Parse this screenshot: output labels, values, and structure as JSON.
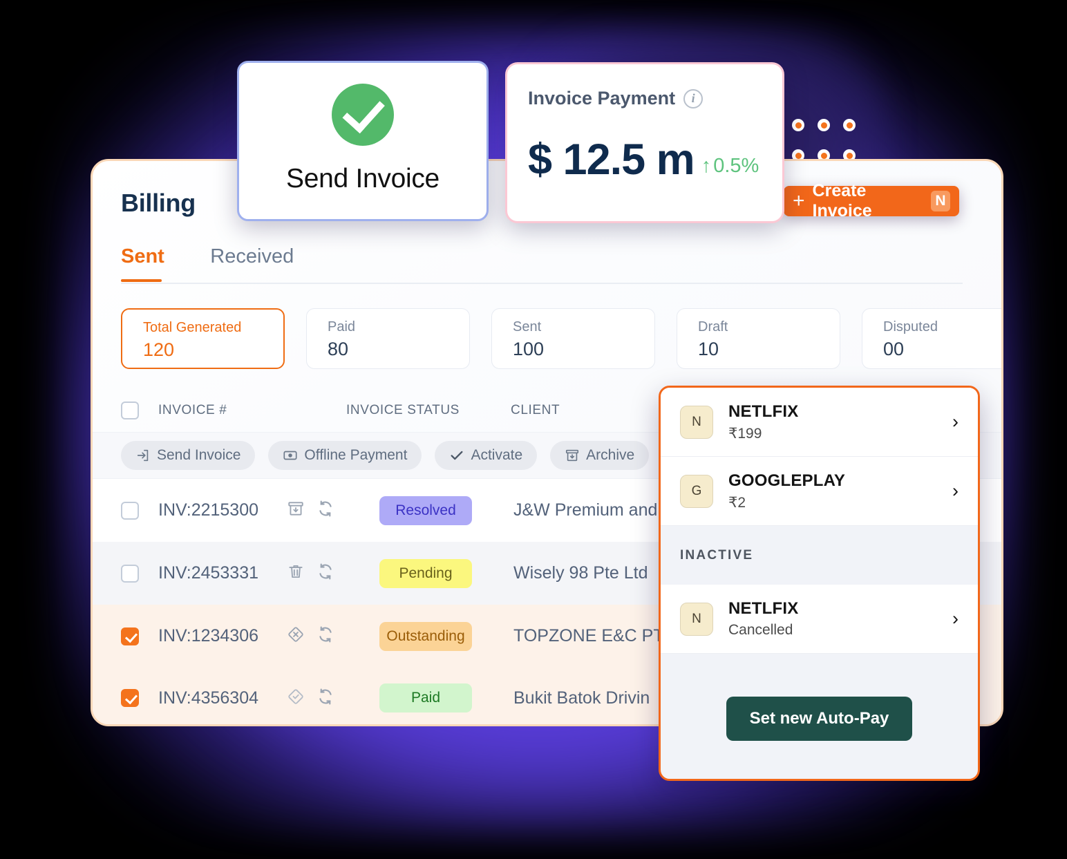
{
  "colors": {
    "accent_orange": "#f2671a",
    "glow_purple": "#633ce6",
    "green_check": "#53b96a",
    "autopay_button_green": "#1f5049"
  },
  "send_invoice_card": {
    "icon": "check-circle-icon",
    "label": "Send Invoice"
  },
  "invoice_payment_card": {
    "title": "Invoice Payment",
    "info_icon": "info-icon",
    "amount": "$ 12.5 m",
    "trend_arrow": "↑",
    "trend_value": "0.5%"
  },
  "billing": {
    "title": "Billing",
    "create_button": {
      "plus": "+",
      "label": "Create Invoice",
      "shortcut": "N"
    },
    "tabs": [
      {
        "label": "Sent",
        "active": true
      },
      {
        "label": "Received",
        "active": false
      }
    ],
    "stats": [
      {
        "label": "Total Generated",
        "value": "120",
        "selected": true
      },
      {
        "label": "Paid",
        "value": "80",
        "selected": false
      },
      {
        "label": "Sent",
        "value": "100",
        "selected": false
      },
      {
        "label": "Draft",
        "value": "10",
        "selected": false
      },
      {
        "label": "Disputed",
        "value": "00",
        "selected": false
      }
    ],
    "table": {
      "columns": [
        "INVOICE #",
        "INVOICE STATUS",
        "CLIENT"
      ],
      "bulk_actions": [
        {
          "label": "Send Invoice",
          "icon": "send-arrow-icon"
        },
        {
          "label": "Offline Payment",
          "icon": "cash-icon"
        },
        {
          "label": "Activate",
          "icon": "check-icon"
        },
        {
          "label": "Archive",
          "icon": "archive-icon"
        },
        {
          "label": "",
          "icon": "trash-icon"
        }
      ],
      "rows": [
        {
          "selected": false,
          "invoice": "INV:2215300",
          "row_icons": [
            "archive-icon",
            "refresh-icon"
          ],
          "status": "Resolved",
          "status_bg": "#aeaaf7",
          "status_fg": "#3b32c4",
          "client": "J&W Premium and"
        },
        {
          "selected": false,
          "invoice": "INV:2453331",
          "row_icons": [
            "trash-icon",
            "refresh-icon"
          ],
          "status": "Pending",
          "status_bg": "#fbf77e",
          "status_fg": "#69621b",
          "client": "Wisely 98 Pte Ltd"
        },
        {
          "selected": true,
          "invoice": "INV:1234306",
          "row_icons": [
            "diamond-x-icon",
            "refresh-icon"
          ],
          "status": "Outstanding",
          "status_bg": "#fbd396",
          "status_fg": "#9a5d08",
          "client": "TOPZONE E&C PT"
        },
        {
          "selected": true,
          "invoice": "INV:4356304",
          "row_icons": [
            "diamond-check-icon",
            "refresh-icon"
          ],
          "status": "Paid",
          "status_bg": "#d2f5cd",
          "status_fg": "#1d7a24",
          "client": "Bukit Batok Drivin"
        }
      ]
    }
  },
  "autopay_panel": {
    "active_items": [
      {
        "logo": "N",
        "name": "NETLFIX",
        "sub": "₹199",
        "chevron": "›"
      },
      {
        "logo": "G",
        "name": "GOOGLEPLAY",
        "sub": "₹2",
        "chevron": "›"
      }
    ],
    "section_label": "INACTIVE",
    "inactive_items": [
      {
        "logo": "N",
        "name": "NETLFIX",
        "sub": "Cancelled",
        "chevron": "›"
      }
    ],
    "cta_label": "Set new Auto-Pay"
  }
}
